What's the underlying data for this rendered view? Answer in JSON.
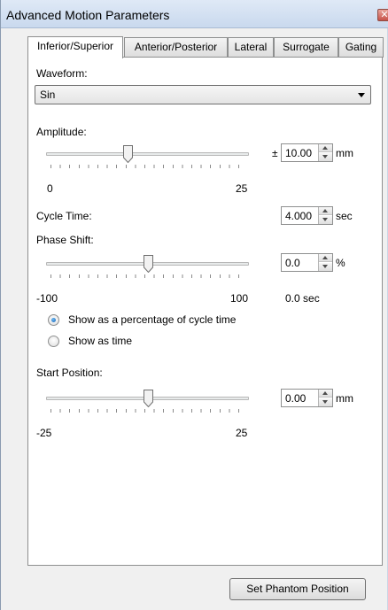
{
  "window": {
    "title": "Advanced Motion Parameters",
    "close_label": "✕"
  },
  "tabs": [
    "Inferior/Superior",
    "Anterior/Posterior",
    "Lateral",
    "Surrogate",
    "Gating"
  ],
  "active_tab": "Inferior/Superior",
  "waveform": {
    "label": "Waveform:",
    "value": "Sin"
  },
  "amplitude": {
    "label": "Amplitude:",
    "prefix": "±",
    "value": "10.00",
    "unit": "mm",
    "min_label": "0",
    "max_label": "25",
    "slider_fraction": 0.4
  },
  "cycle_time": {
    "label": "Cycle Time:",
    "value": "4.000",
    "unit": "sec"
  },
  "phase_shift": {
    "label": "Phase Shift:",
    "value": "0.0",
    "unit": "%",
    "min_label": "-100",
    "max_label": "100",
    "time_readout": "0.0 sec",
    "slider_fraction": 0.5
  },
  "radios": {
    "percentage_label": "Show as a percentage of cycle time",
    "time_label": "Show as time",
    "selected": "percentage"
  },
  "start_position": {
    "label": "Start Position:",
    "value": "0.00",
    "unit": "mm",
    "min_label": "-25",
    "max_label": "25",
    "slider_fraction": 0.5
  },
  "buttons": {
    "set_phantom_position": "Set Phantom Position"
  },
  "colors": {
    "titlebar": "#c9d9ee",
    "panel": "#ffffff",
    "radio_selected": "#1463b8"
  }
}
